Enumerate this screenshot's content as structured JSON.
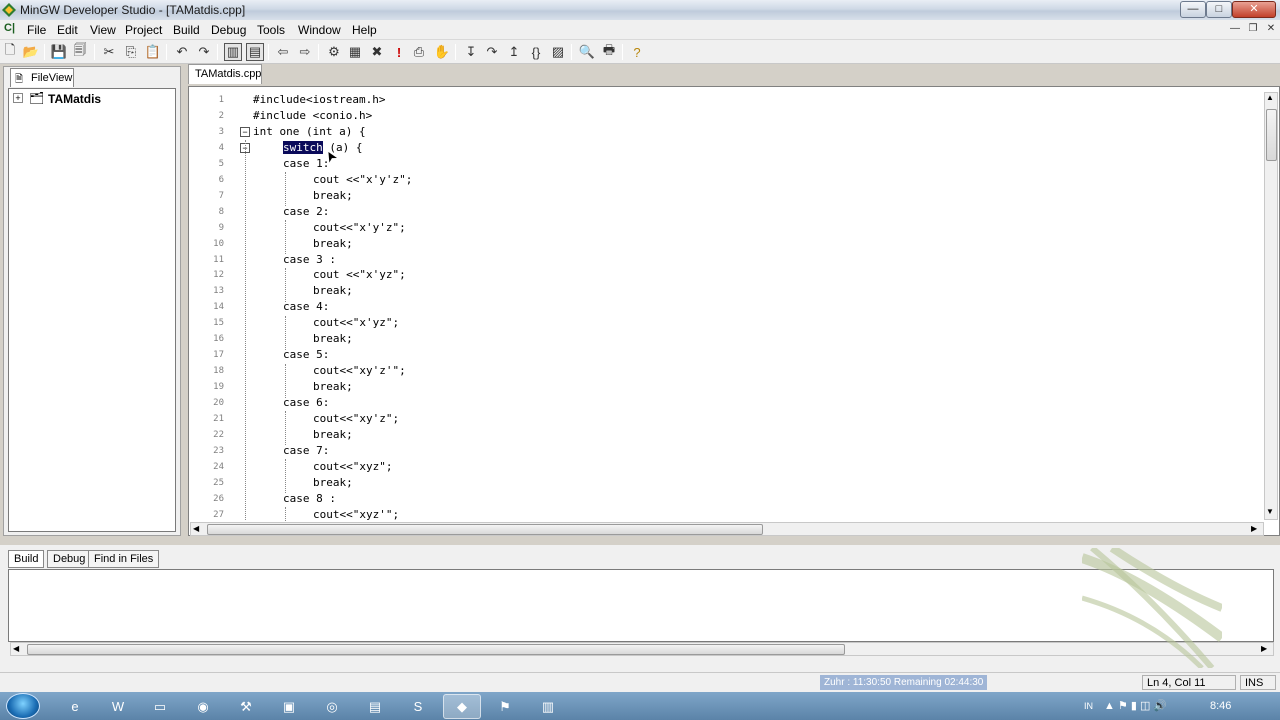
{
  "window": {
    "title": "MinGW Developer Studio - [TAMatdis.cpp]"
  },
  "menu": [
    "File",
    "Edit",
    "View",
    "Project",
    "Build",
    "Debug",
    "Tools",
    "Window",
    "Help"
  ],
  "toolbar_icons": [
    "new-file-icon",
    "open-icon",
    "save-icon",
    "save-all-icon",
    "cut-icon",
    "copy-icon",
    "paste-icon",
    "undo-icon",
    "redo-icon",
    "workspace-icon",
    "output-icon",
    "back-icon",
    "forward-icon",
    "compile-icon",
    "build-icon",
    "stop-icon",
    "execute-icon",
    "rebuild-icon",
    "run-icon",
    "step-into-icon",
    "step-over-icon",
    "step-out-icon",
    "step-to-cursor-icon",
    "watch-icon",
    "find-icon",
    "print-icon",
    "help-icon"
  ],
  "left_panel": {
    "tab": "FileView",
    "project": "TAMatdis"
  },
  "editor": {
    "tab": "TAMatdis.cpp",
    "lines": [
      {
        "n": "1",
        "text": "#include<iostream.h>"
      },
      {
        "n": "2",
        "text": "#include <conio.h>"
      },
      {
        "n": "3",
        "text": "int one (int a) {"
      },
      {
        "n": "4",
        "text": "switch (a) {"
      },
      {
        "n": "5",
        "text": "case 1:"
      },
      {
        "n": "6",
        "text": "cout <<\"x'y'z\";"
      },
      {
        "n": "7",
        "text": "break;"
      },
      {
        "n": "8",
        "text": "case 2:"
      },
      {
        "n": "9",
        "text": "cout<<\"x'y'z\";"
      },
      {
        "n": "10",
        "text": "break;"
      },
      {
        "n": "11",
        "text": "case 3 :"
      },
      {
        "n": "12",
        "text": "cout <<\"x'yz\";"
      },
      {
        "n": "13",
        "text": "break;"
      },
      {
        "n": "14",
        "text": "case 4:"
      },
      {
        "n": "15",
        "text": "cout<<\"x'yz\";"
      },
      {
        "n": "16",
        "text": "break;"
      },
      {
        "n": "17",
        "text": "case 5:"
      },
      {
        "n": "18",
        "text": "cout<<\"xy'z'\";"
      },
      {
        "n": "19",
        "text": "break;"
      },
      {
        "n": "20",
        "text": "case 6:"
      },
      {
        "n": "21",
        "text": "cout<<\"xy'z\";"
      },
      {
        "n": "22",
        "text": "break;"
      },
      {
        "n": "23",
        "text": "case 7:"
      },
      {
        "n": "24",
        "text": "cout<<\"xyz\";"
      },
      {
        "n": "25",
        "text": "break;"
      },
      {
        "n": "26",
        "text": "case 8 :"
      },
      {
        "n": "27",
        "text": "cout<<\"xyz'\";"
      }
    ],
    "selected_word": "switch"
  },
  "output": {
    "tabs": [
      "Build",
      "Debug",
      "Find in Files"
    ]
  },
  "status": {
    "timer": "Zuhr : 11:30:50  Remaining 02:44:30",
    "position": "Ln 4, Col 11",
    "mode": "INS"
  },
  "taskbar": {
    "clock": "8:46",
    "lang": "IN"
  }
}
